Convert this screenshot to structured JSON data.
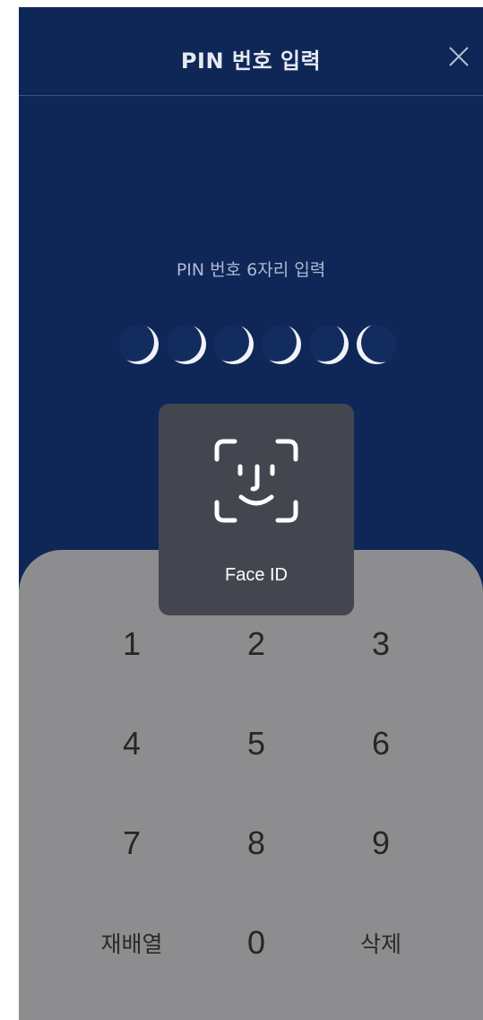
{
  "header": {
    "title": "PIN 번호 입력",
    "close_icon": "close-icon"
  },
  "pin": {
    "prompt": "PIN 번호 6자리 입력",
    "length": 6,
    "entered": 0
  },
  "faceid_overlay": {
    "icon": "face-id-icon",
    "label": "Face ID"
  },
  "keypad": {
    "keys": [
      "1",
      "2",
      "3",
      "4",
      "5",
      "6",
      "7",
      "8",
      "9",
      "재배열",
      "0",
      "삭제"
    ]
  },
  "colors": {
    "background": "#0f2757",
    "keypad": "#8d8d8f",
    "overlay": "#44464f"
  }
}
